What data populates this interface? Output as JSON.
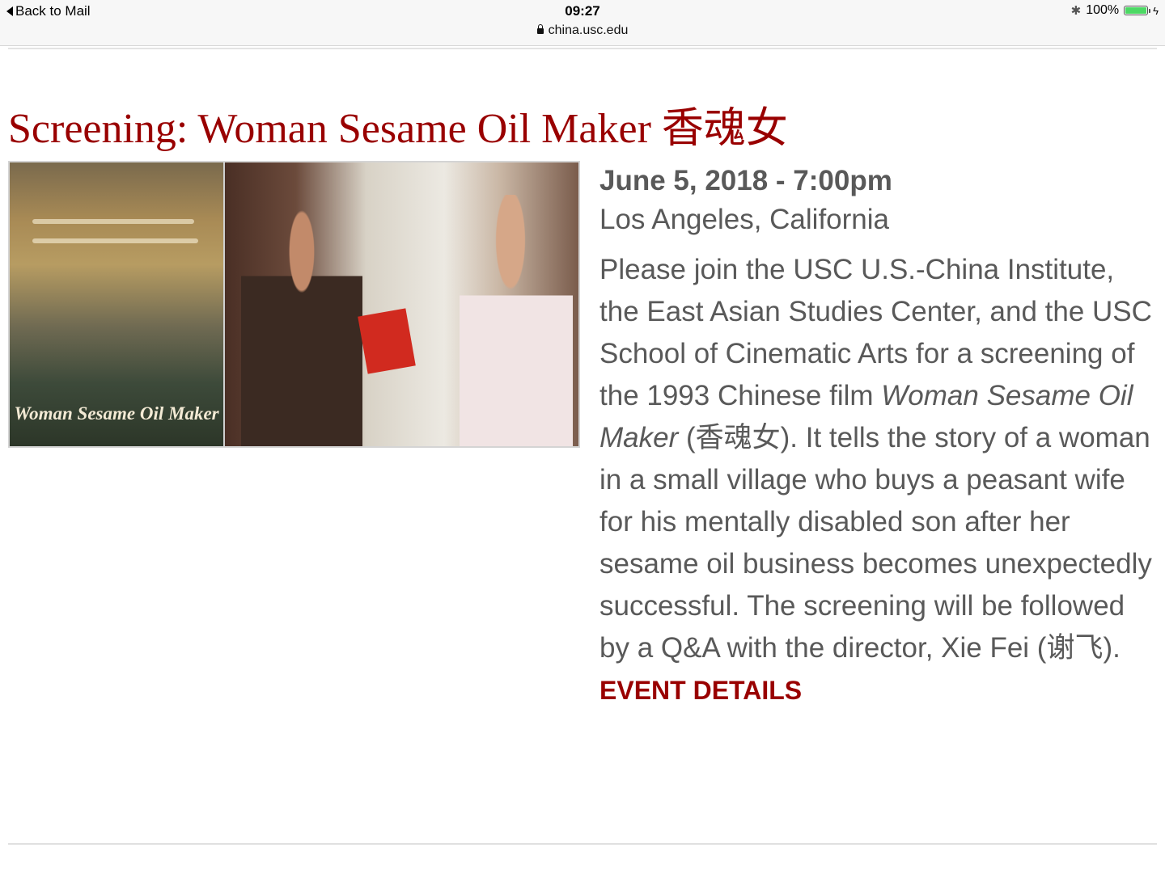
{
  "status_bar": {
    "back_label": "Back to Mail",
    "time": "09:27",
    "url": "china.usc.edu",
    "battery_percent": "100%",
    "battery_level": 1.0,
    "battery_color": "#4cd964"
  },
  "article": {
    "title": "Screening: Woman Sesame Oil Maker 香魂女",
    "image_caption": "Woman Sesame Oil Maker",
    "date": "June 5, 2018 - 7:00pm",
    "location": "Los Angeles, California",
    "description_part1": "Please join the USC U.S.-China Institute, the East Asian Studies Center, and the USC School of Cinematic Arts for a screening of the 1993 Chinese film ",
    "description_film": "Woman Sesame Oil Maker",
    "description_part2": " (香魂女). It tells the story of a woman in a small village who buys a peasant wife for his mentally disabled son after her sesame oil business becomes unexpectedly successful. The screening will be followed by a Q&A with the director, Xie Fei (谢飞).",
    "details_link": "EVENT DETAILS"
  },
  "colors": {
    "accent": "#990000",
    "body_text": "#595959"
  }
}
